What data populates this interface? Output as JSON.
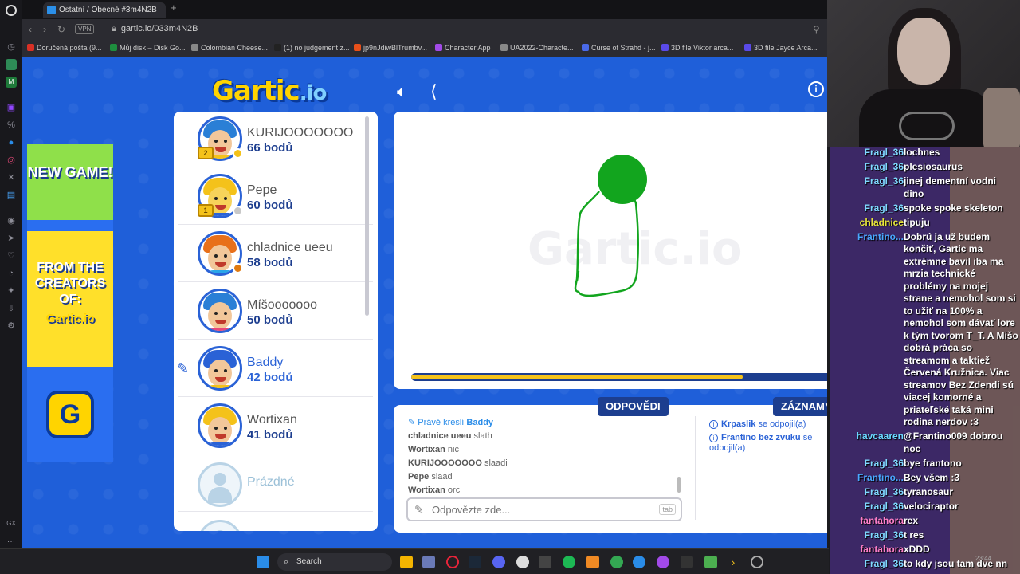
{
  "browser": {
    "tab_title": "Ostatní / Obecné #3m4N2B",
    "new_tab": "+",
    "vpn": "VPN",
    "url": "gartic.io/033m4N2B",
    "bookmarks": [
      {
        "label": "Doručená pošta (9..."
      },
      {
        "label": "Můj disk – Disk Go..."
      },
      {
        "label": "Colombian Cheese..."
      },
      {
        "label": "(1) no judgement z..."
      },
      {
        "label": "jp9nJdiwBlTrumbv..."
      },
      {
        "label": "Character App"
      },
      {
        "label": "UA2022-Characte..."
      },
      {
        "label": "Curse of Strahd - j..."
      },
      {
        "label": "3D file Viktor arca..."
      },
      {
        "label": "3D file Jayce Arca..."
      }
    ]
  },
  "game": {
    "logo": "Gartic",
    "logo_io": ".io",
    "ad": {
      "new_game": "NEW GAME!",
      "from_creators": "FROM THE CREATORS OF:",
      "brand": "Gartic.io",
      "badge": "G"
    },
    "players": [
      {
        "name": "KURIJOOOOOOO",
        "score": "66 bodů",
        "dot": "#f4c21a",
        "trophy": "2",
        "hair": "#2a7fd6",
        "skin": "#f2c79a",
        "shirt": "#f4c21a"
      },
      {
        "name": "Pepe",
        "score": "60 bodů",
        "dot": "#c8c8c8",
        "trophy": "1",
        "hair": "#f4c21a",
        "skin": "#f7d35a",
        "shirt": "#2a62d6"
      },
      {
        "name": "chladnice ueeu",
        "score": "58 bodů",
        "dot": "#e07a10",
        "trophy": "",
        "hair": "#e8701a",
        "skin": "#f2c79a",
        "shirt": "#2aa6e8"
      },
      {
        "name": "Míšooooooo",
        "score": "50 bodů",
        "dot": "",
        "trophy": "",
        "hair": "#2a7fd6",
        "skin": "#f2c79a",
        "shirt": "#e84a7a"
      },
      {
        "name": "Baddy",
        "score": "42 bodů",
        "dot": "",
        "trophy": "",
        "hair": "#2a62d6",
        "skin": "#f2c79a",
        "shirt": "#f4c21a"
      },
      {
        "name": "Wortixan",
        "score": "41 bodů",
        "dot": "",
        "trophy": "",
        "hair": "#f4c21a",
        "skin": "#f2c79a",
        "shirt": "#2a62d6"
      }
    ],
    "empty_slot": "Prázdné",
    "timer_fraction": 0.76,
    "answers_title": "ODPOVĚDI",
    "records_title": "ZÁZNAMY",
    "now_drawing_prefix": "Právě kreslí",
    "now_drawing_user": "Baddy",
    "answers": [
      {
        "user": "chladnice ueeu",
        "text": "slath"
      },
      {
        "user": "Wortixan",
        "text": "nic"
      },
      {
        "user": "KURIJOOOOOOO",
        "text": "slaadi"
      },
      {
        "user": "Pepe",
        "text": "slaad"
      },
      {
        "user": "Wortixan",
        "text": "orc"
      }
    ],
    "records": [
      {
        "user": "Krpaslik",
        "text": "se odpojil(a)"
      },
      {
        "user": "Frantíno bez zvuku",
        "text": "se odpojil(a)"
      }
    ],
    "answer_placeholder": "Odpovězte zde...",
    "tab_key": "tab"
  },
  "chat": [
    {
      "user": "Fragl_36",
      "color": "#7fd8ff",
      "text": "lochnes"
    },
    {
      "user": "Fragl_36",
      "color": "#7fd8ff",
      "text": "plesiosaurus"
    },
    {
      "user": "Fragl_36",
      "color": "#7fd8ff",
      "text": "jinej dementní vodni dino"
    },
    {
      "user": "Fragl_36",
      "color": "#7fd8ff",
      "text": "spoke spoke skeleton"
    },
    {
      "user": "chladnice",
      "color": "#e8e63a",
      "text": "tipuju"
    },
    {
      "user": "Frantino...",
      "color": "#4aa8ff",
      "text": "Dobrú ja už budem končiť, Gartic ma extrémne bavil iba ma mrzia technické problémy na mojej strane a nemohol som si to užiť na 100% a nemohol som dávať lore k tým tvorom T_T. A Mišo dobrá práca so streamom a taktiež Červená Kružnica. Viac streamov Bez Zdendi sú viacej komorné a priateľské taká mini rodina nerdov :3"
    },
    {
      "user": "havcaaren",
      "color": "#6ad8ff",
      "text": "@Frantino009 dobrou noc"
    },
    {
      "user": "Fragl_36",
      "color": "#7fd8ff",
      "text": "bye frantono"
    },
    {
      "user": "Frantino...",
      "color": "#4aa8ff",
      "text": "Bey všem :3"
    },
    {
      "user": "Fragl_36",
      "color": "#7fd8ff",
      "text": "tyranosaur"
    },
    {
      "user": "Fragl_36",
      "color": "#7fd8ff",
      "text": "velociraptor"
    },
    {
      "user": "fantahora",
      "color": "#ff7fc8",
      "text": "rex"
    },
    {
      "user": "Fragl_36",
      "color": "#7fd8ff",
      "text": "t res"
    },
    {
      "user": "fantahora",
      "color": "#ff7fc8",
      "text": "xDDD"
    },
    {
      "user": "Fragl_36",
      "color": "#7fd8ff",
      "text": "to kdy jsou tam dve nn"
    }
  ],
  "taskbar": {
    "search": "Search",
    "clock": "23:44"
  }
}
